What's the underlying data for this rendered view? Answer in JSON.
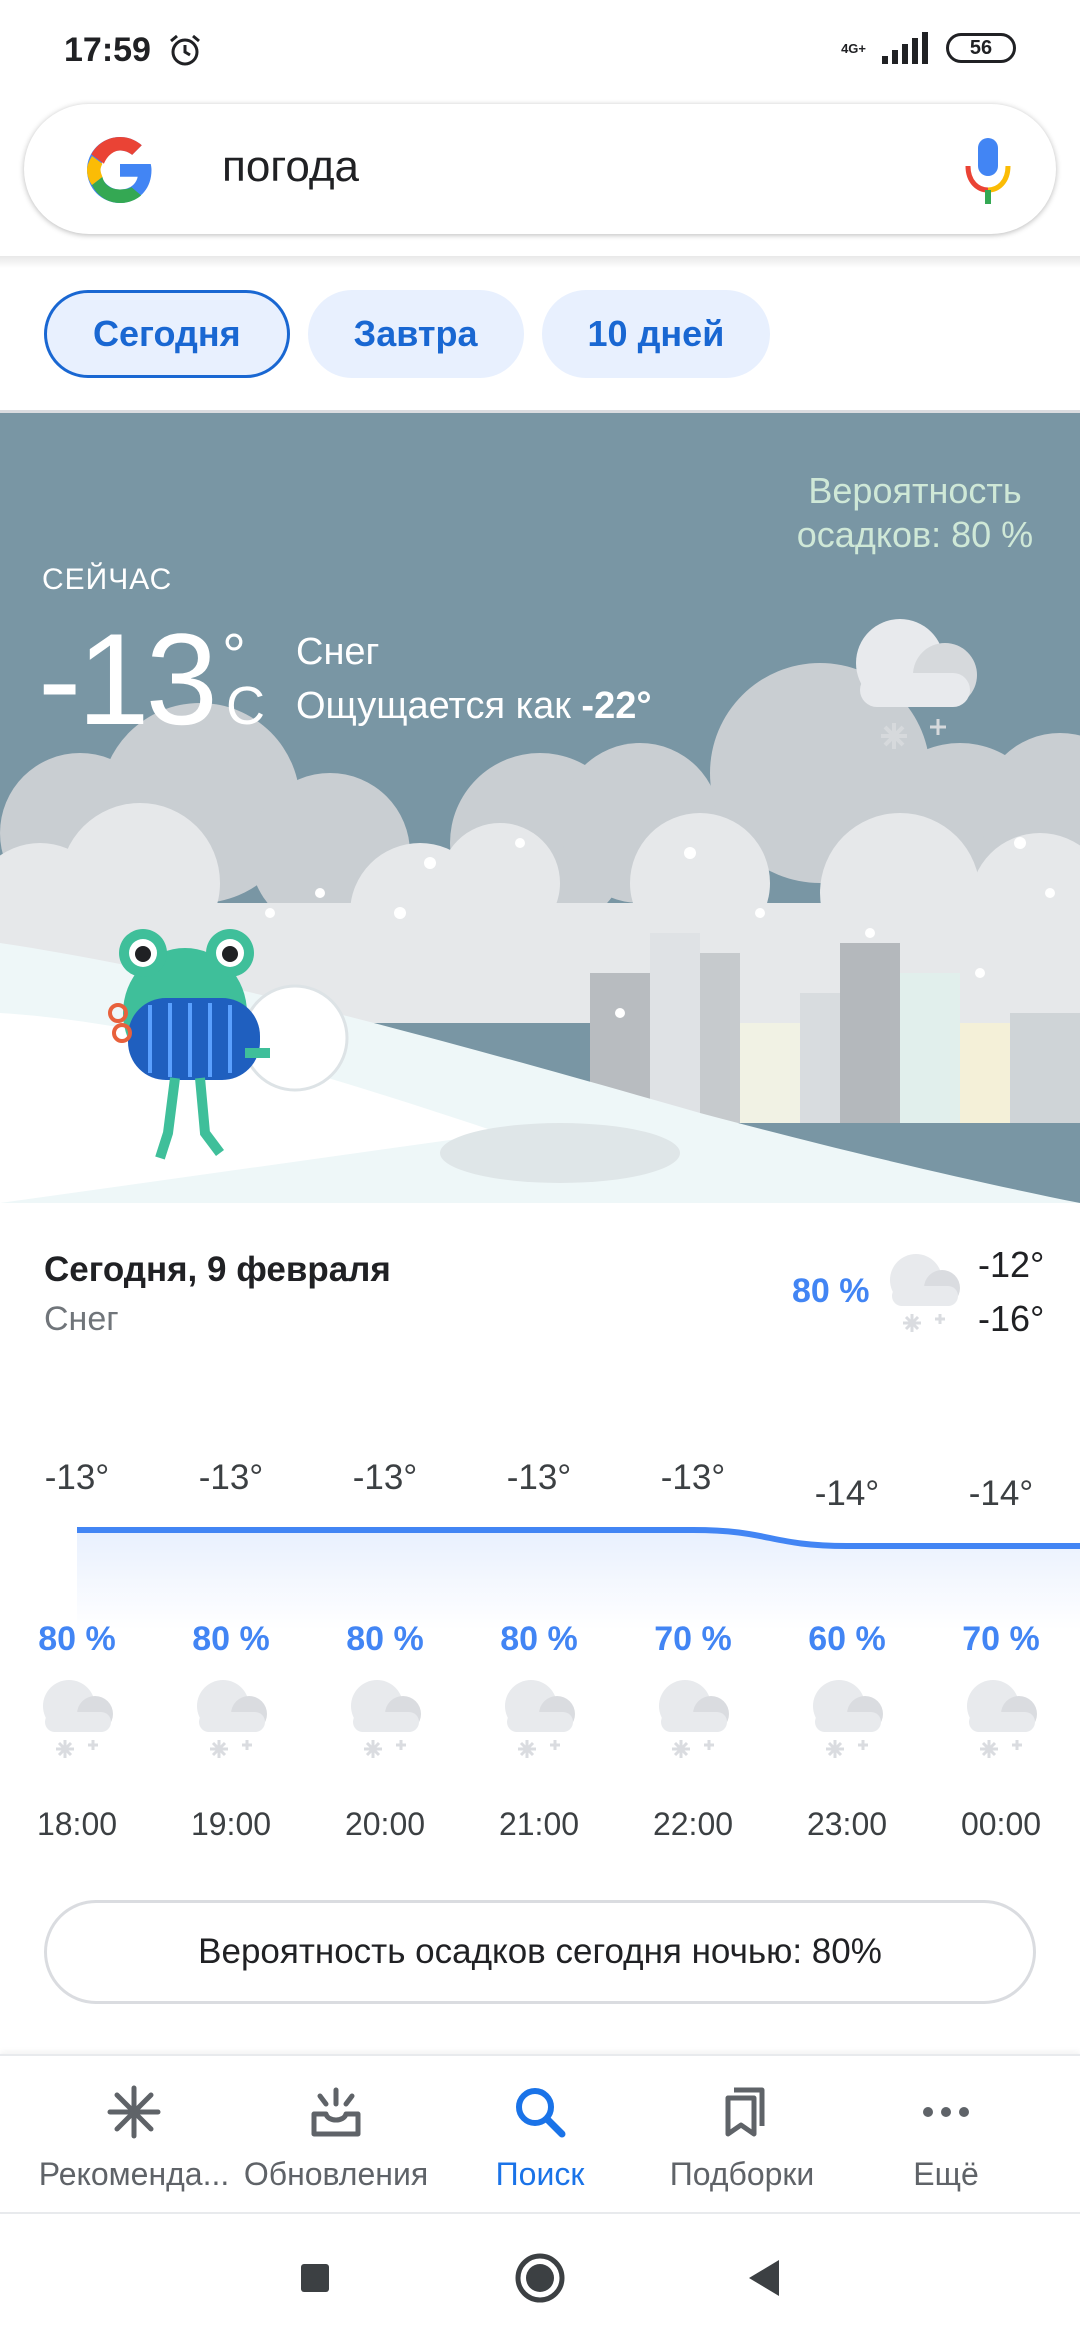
{
  "status_bar": {
    "time": "17:59",
    "network_type": "4G+",
    "battery": "56"
  },
  "search": {
    "query": "погода"
  },
  "tabs": [
    {
      "label": "Сегодня",
      "active": true
    },
    {
      "label": "Завтра",
      "active": false
    },
    {
      "label": "10 дней",
      "active": false
    }
  ],
  "current": {
    "now_label": "СЕЙЧАС",
    "temperature": "-13",
    "degree": "°",
    "unit": "C",
    "condition": "Снег",
    "feels_like_prefix": "Ощущается как",
    "feels_like_value": "-22°",
    "precip_chance": "Вероятность осадков: 80 %"
  },
  "today": {
    "title": "Сегодня, 9 февраля",
    "condition": "Снег",
    "precip": "80 %",
    "high": "-12°",
    "low": "-16°"
  },
  "hourly": [
    {
      "time": "18:00",
      "temp": "-13°",
      "precip": "80 %"
    },
    {
      "time": "19:00",
      "temp": "-13°",
      "precip": "80 %"
    },
    {
      "time": "20:00",
      "temp": "-13°",
      "precip": "80 %"
    },
    {
      "time": "21:00",
      "temp": "-13°",
      "precip": "80 %"
    },
    {
      "time": "22:00",
      "temp": "-13°",
      "precip": "70 %"
    },
    {
      "time": "23:00",
      "temp": "-14°",
      "precip": "60 %"
    },
    {
      "time": "00:00",
      "temp": "-14°",
      "precip": "70 %"
    }
  ],
  "chart_data": {
    "type": "line",
    "categories": [
      "18:00",
      "19:00",
      "20:00",
      "21:00",
      "22:00",
      "23:00",
      "00:00"
    ],
    "series": [
      {
        "values": [
          -13,
          -13,
          -13,
          -13,
          -13,
          -14,
          -14
        ]
      }
    ],
    "precipitation_percent": [
      80,
      80,
      80,
      80,
      70,
      60,
      70
    ],
    "color": "#4285f4"
  },
  "precip_tonight": "Вероятность осадков сегодня ночью: 80%",
  "bottom_nav": [
    {
      "label": "Рекоменда...",
      "icon": "asterisk-icon",
      "active": false
    },
    {
      "label": "Обновления",
      "icon": "inbox-updates-icon",
      "active": false
    },
    {
      "label": "Поиск",
      "icon": "search-icon",
      "active": true
    },
    {
      "label": "Подборки",
      "icon": "collections-icon",
      "active": false
    },
    {
      "label": "Ещё",
      "icon": "more-icon",
      "active": false
    }
  ],
  "colors": {
    "accent": "#1a73e8",
    "precip_blue": "#4285f4",
    "hero_sky": "#7996a4"
  }
}
